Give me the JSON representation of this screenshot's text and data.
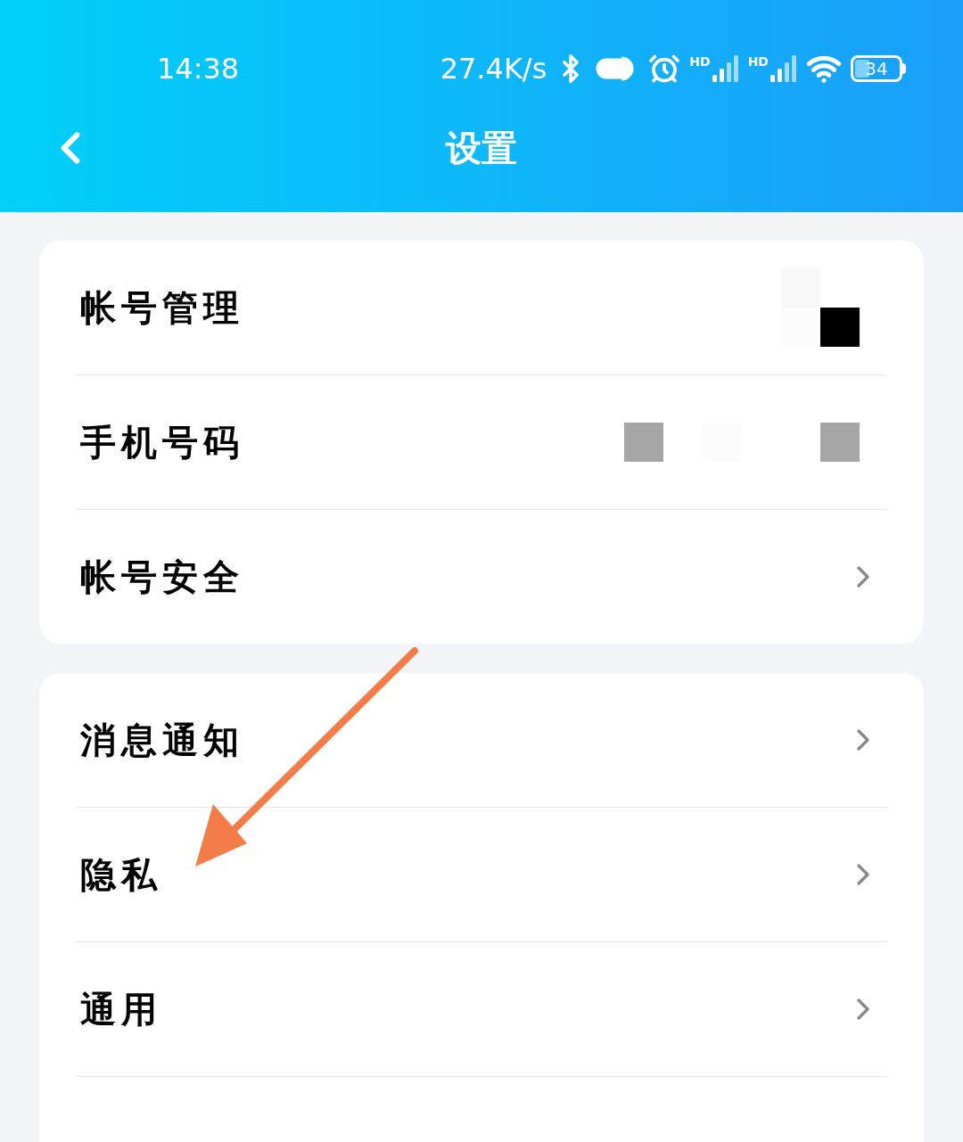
{
  "status_bar": {
    "time": "14:38",
    "net_speed": "27.4K/s",
    "signal_labels": [
      "HD",
      "HD"
    ],
    "battery": "34"
  },
  "header": {
    "title": "设置"
  },
  "groups": [
    [
      {
        "label": "帐号管理",
        "kind": "mosaic",
        "color": "#000000"
      },
      {
        "label": "手机号码",
        "kind": "mosaic",
        "color": "#a6a6a6"
      },
      {
        "label": "帐号安全",
        "kind": "chevron"
      }
    ],
    [
      {
        "label": "消息通知",
        "kind": "chevron"
      },
      {
        "label": "隐私",
        "kind": "chevron"
      },
      {
        "label": "通用",
        "kind": "chevron"
      }
    ]
  ],
  "annotation": {
    "kind": "arrow"
  }
}
